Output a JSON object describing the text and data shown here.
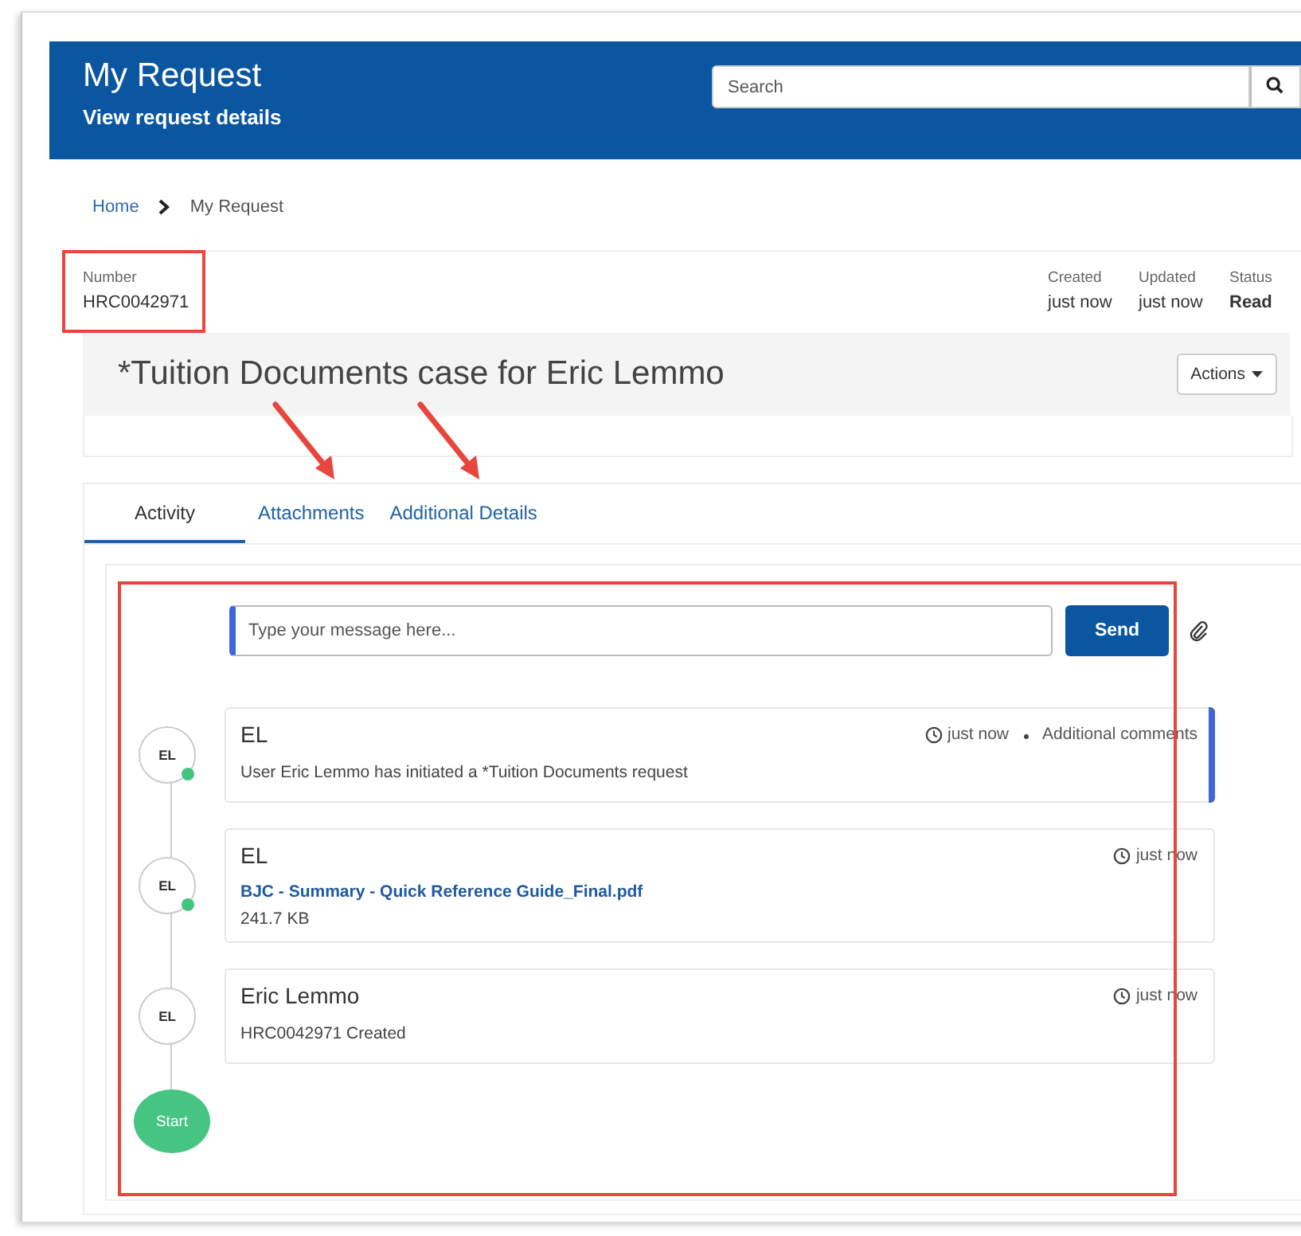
{
  "header": {
    "title": "My Request",
    "subtitle": "View request details",
    "search": {
      "placeholder": "Search"
    }
  },
  "breadcrumb": [
    {
      "label": "Home",
      "link": true
    },
    {
      "label": "My Request",
      "link": false
    }
  ],
  "number": {
    "label": "Number",
    "value": "HRC0042971"
  },
  "meta": [
    {
      "label": "Created",
      "value": "just now",
      "bold": false
    },
    {
      "label": "Updated",
      "value": "just now",
      "bold": false
    },
    {
      "label": "Status",
      "value": "Read",
      "bold": true
    }
  ],
  "case_title": "*Tuition Documents case for Eric Lemmo",
  "actions_button": "Actions",
  "tabs": [
    {
      "label": "Activity",
      "selected": true
    },
    {
      "label": "Attachments",
      "selected": false
    },
    {
      "label": "Additional Details",
      "selected": false
    }
  ],
  "composer": {
    "placeholder": "Type your message here...",
    "send": "Send"
  },
  "entries": [
    {
      "kind": "comment",
      "initials": "EL",
      "online": true,
      "author": "EL",
      "time": "just now",
      "source": "Additional comments",
      "highlighted": true,
      "text": "User Eric Lemmo has initiated a *Tuition Documents  request"
    },
    {
      "kind": "attachment",
      "initials": "EL",
      "online": true,
      "author": "EL",
      "time": "just now",
      "highlighted": false,
      "file": "BJC - Summary - Quick Reference Guide_Final.pdf",
      "size": "241.7 KB"
    },
    {
      "kind": "comment",
      "initials": "EL",
      "online": false,
      "author": "Eric Lemmo",
      "time": "just now",
      "highlighted": false,
      "text": "HRC0042971 Created"
    }
  ],
  "start_label": "Start"
}
